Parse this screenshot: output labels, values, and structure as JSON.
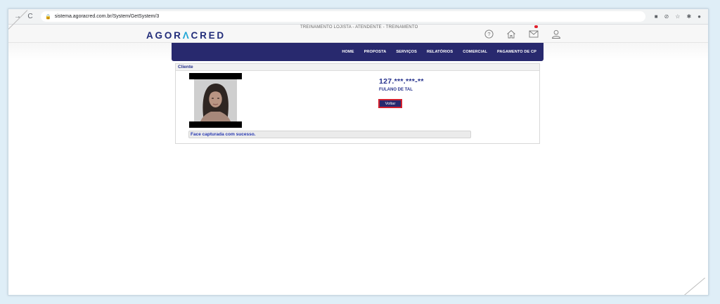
{
  "browser": {
    "url": "sistema.agoracred.com.br/System/GetSystem/3",
    "back_icon": "arrow-right-icon",
    "reload_icon": "reload-icon"
  },
  "header": {
    "title": "TREINAMENTO LOJISTA - ATENDENTE - TREINAMENTO",
    "logo_left": "AGOR",
    "logo_mid": "Λ",
    "logo_right": "CRED"
  },
  "menu": {
    "items": [
      "HOME",
      "PROPOSTA",
      "SERVIÇOS",
      "RELATÓRIOS",
      "COMERCIAL",
      "PAGAMENTO DE CP"
    ]
  },
  "panel": {
    "title": "Cliente",
    "cpf": "127.***.***-**",
    "name": "FULANO DE TAL",
    "back_button": "Voltar",
    "message": "Face capturada com sucesso."
  },
  "colors": {
    "primary": "#28296e",
    "accent": "#1ea6d6",
    "danger": "#d2202e",
    "text_blue": "#25318c"
  }
}
